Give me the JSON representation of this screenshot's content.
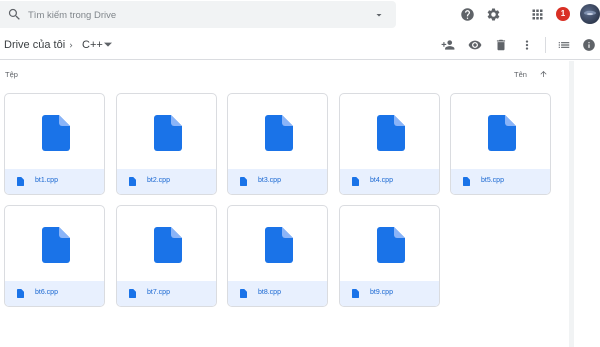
{
  "search": {
    "placeholder": "Tìm kiếm trong Drive"
  },
  "header": {
    "notification_count": "1"
  },
  "breadcrumb": {
    "root": "Drive của tôi",
    "current": "C++"
  },
  "list": {
    "files_heading": "Tệp",
    "sort_label": "Tên"
  },
  "files": [
    {
      "name": "bt1.cpp"
    },
    {
      "name": "bt2.cpp"
    },
    {
      "name": "bt3.cpp"
    },
    {
      "name": "bt4.cpp"
    },
    {
      "name": "bt5.cpp"
    },
    {
      "name": "bt6.cpp"
    },
    {
      "name": "bt7.cpp"
    },
    {
      "name": "bt8.cpp"
    },
    {
      "name": "bt9.cpp"
    }
  ],
  "icons": {
    "search": "search-icon",
    "search_options": "search-options-icon",
    "help": "help-icon",
    "settings": "gear-icon",
    "apps": "apps-grid-icon",
    "share": "add-person-icon",
    "preview": "eye-icon",
    "delete": "trash-icon",
    "more": "more-vert-icon",
    "list_view": "list-view-icon",
    "info": "info-icon",
    "file": "document-icon"
  },
  "colors": {
    "accent": "#1a73e8",
    "file_icon": "#1a73e8",
    "footer_bg": "#e8f0fe",
    "notification": "#d93025"
  }
}
